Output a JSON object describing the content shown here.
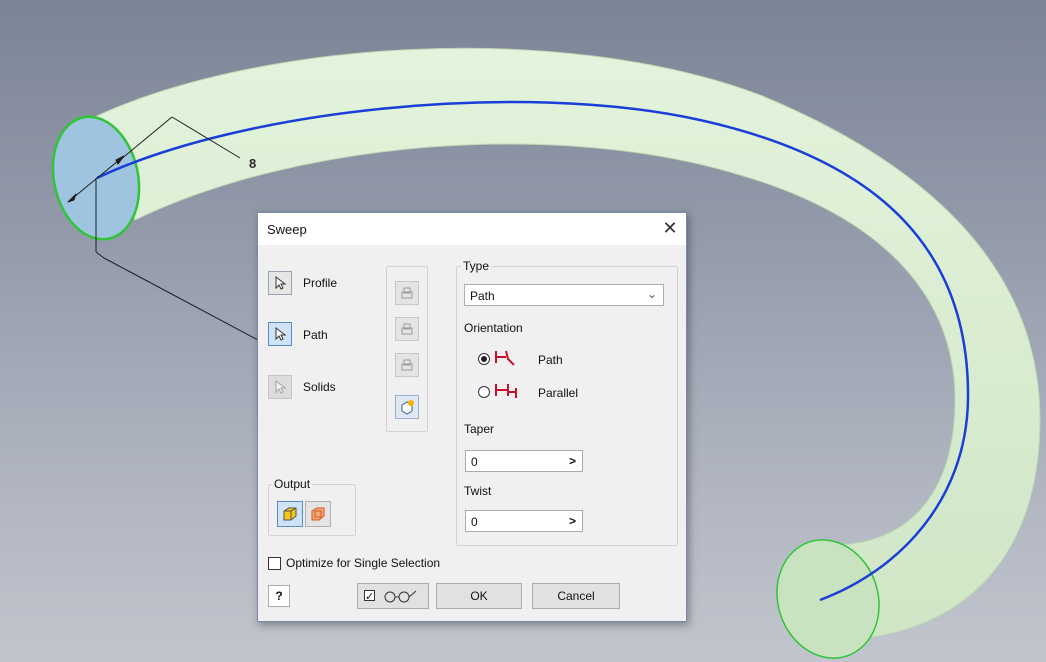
{
  "viewport": {
    "dimension_value": "8"
  },
  "dialog": {
    "title": "Sweep",
    "close_glyph": "✕",
    "selectors": [
      {
        "label": "Profile",
        "icon": "cursor-arrow-icon",
        "state": "normal"
      },
      {
        "label": "Path",
        "icon": "cursor-arrow-icon",
        "state": "active"
      },
      {
        "label": "Solids",
        "icon": "cursor-arrow-icon",
        "state": "disabled"
      }
    ],
    "type_group": {
      "title": "Type",
      "selected": "Path",
      "orientation_title": "Orientation",
      "orientation_options": [
        {
          "label": "Path",
          "checked": true,
          "icon": "path-orientation-icon"
        },
        {
          "label": "Parallel",
          "checked": false,
          "icon": "parallel-orientation-icon"
        }
      ],
      "taper_label": "Taper",
      "taper_value": "0",
      "twist_label": "Twist",
      "twist_value": "0",
      "stepper_glyph": ">"
    },
    "output": {
      "title": "Output",
      "options": [
        "solid-output-icon",
        "surface-output-icon"
      ],
      "selected": "solid-output-icon"
    },
    "optimize_label": "Optimize for Single Selection",
    "optimize_checked": false,
    "footer": {
      "help_glyph": "?",
      "ok_label": "OK",
      "cancel_label": "Cancel"
    }
  },
  "colors": {
    "tube_fill": "#d7edd0",
    "path_line": "#1a3ed8",
    "profile_edge": "#2fc43a",
    "profile_face": "#9fc4df",
    "dialog_bg": "#f0f0f0",
    "active_button": "#cfe3f7"
  }
}
